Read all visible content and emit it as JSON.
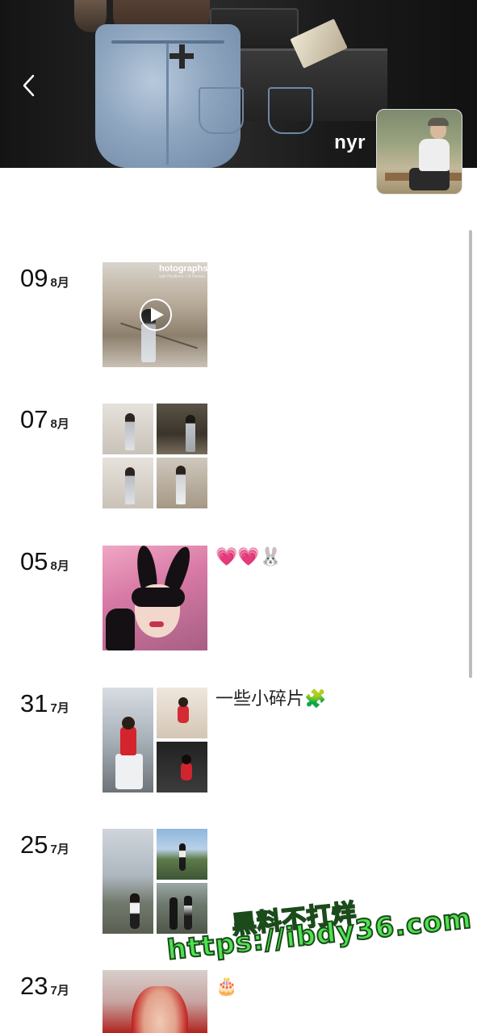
{
  "profile": {
    "username": "nyr"
  },
  "icons": {
    "back": "chevron-left-icon",
    "play": "play-icon"
  },
  "posts": [
    {
      "day": "09",
      "month": "8月",
      "type": "video",
      "caption": "",
      "photo_text": "hotographs",
      "photo_subtext": "with Pavilions, LA Terrace"
    },
    {
      "day": "07",
      "month": "8月",
      "type": "grid4",
      "caption": ""
    },
    {
      "day": "05",
      "month": "8月",
      "type": "single",
      "caption": "💗💗🐰"
    },
    {
      "day": "31",
      "month": "7月",
      "type": "grid3",
      "caption": "一些小碎片🧩"
    },
    {
      "day": "25",
      "month": "7月",
      "type": "grid3",
      "caption": ""
    },
    {
      "day": "23",
      "month": "7月",
      "type": "single",
      "caption": "🎂"
    }
  ],
  "watermark": {
    "line1": "黑料不打烊",
    "line2": "https://ibdy36.com"
  },
  "colors": {
    "watermark": "#4fe14f",
    "background": "#ffffff"
  }
}
